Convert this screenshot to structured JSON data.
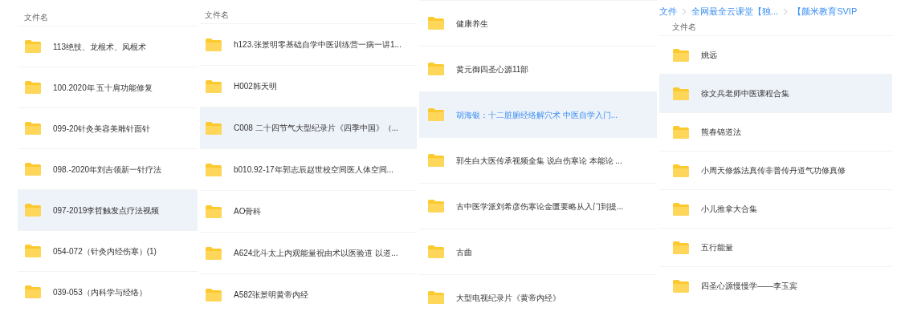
{
  "panels": [
    {
      "header": "文件名",
      "rows": [
        {
          "name": "113绝技、龙根术、凤根术",
          "highlighted": false,
          "active": false
        },
        {
          "name": "100.2020年 五十肩功能修复",
          "highlighted": false,
          "active": false
        },
        {
          "name": "099-20针灸美容美雕针面针",
          "highlighted": false,
          "active": false
        },
        {
          "name": "098.-2020年刘吉领新一针疗法",
          "highlighted": false,
          "active": false
        },
        {
          "name": "097-2019李哲触发点疗法视频",
          "highlighted": true,
          "active": false
        },
        {
          "name": "054-072（针灸内经伤寒）(1)",
          "highlighted": false,
          "active": false
        },
        {
          "name": "039-053（内科学与经络）",
          "highlighted": false,
          "active": false
        }
      ]
    },
    {
      "header": "文件名",
      "rows": [
        {
          "name": "h123.张景明零基础自学中医训练营一病一讲1...",
          "highlighted": false,
          "active": false
        },
        {
          "name": "H002韩天明",
          "highlighted": false,
          "active": false
        },
        {
          "name": "C008 二十四节气大型纪录片《四季中国》（...",
          "highlighted": true,
          "active": false
        },
        {
          "name": "b010.92-17年郭志辰赵世校空间医人体空间...",
          "highlighted": false,
          "active": false
        },
        {
          "name": "AO骨科",
          "highlighted": false,
          "active": false
        },
        {
          "name": "A624北斗太上内观能量祝由术以医验道 以道...",
          "highlighted": false,
          "active": false
        },
        {
          "name": "A582张景明黄帝内经",
          "highlighted": false,
          "active": false
        }
      ]
    },
    {
      "rows": [
        {
          "name": "健康养生",
          "highlighted": false,
          "active": false
        },
        {
          "name": "黄元御四圣心源11部",
          "highlighted": false,
          "active": false
        },
        {
          "name": "胡海银：十二脏腑经络解穴术 中医自学入门...",
          "highlighted": true,
          "active": true
        },
        {
          "name": "郭生白大医传承视频全集 说白伤寒论 本能论 ...",
          "highlighted": false,
          "active": false
        },
        {
          "name": "古中医学派刘希彦伤寒论金匮要略从入门到提...",
          "highlighted": false,
          "active": false
        },
        {
          "name": "古曲",
          "highlighted": false,
          "active": false
        },
        {
          "name": "大型电视纪录片《黄帝内经》",
          "highlighted": false,
          "active": false
        }
      ]
    },
    {
      "breadcrumb": [
        "文件",
        "全网最全云课堂【独...",
        "【颜米教育SVIP"
      ],
      "header": "文件名",
      "rows": [
        {
          "name": "姚远",
          "highlighted": false,
          "active": false
        },
        {
          "name": "徐文兵老师中医课程合集",
          "highlighted": true,
          "active": false
        },
        {
          "name": "熊春锦道法",
          "highlighted": false,
          "active": false
        },
        {
          "name": "小周天修炼法真传非普传丹道气功修真修",
          "highlighted": false,
          "active": false
        },
        {
          "name": "小儿推拿大合集",
          "highlighted": false,
          "active": false
        },
        {
          "name": "五行能量",
          "highlighted": false,
          "active": false
        },
        {
          "name": "四圣心源慢慢学——李玉宾",
          "highlighted": false,
          "active": false
        }
      ]
    }
  ]
}
